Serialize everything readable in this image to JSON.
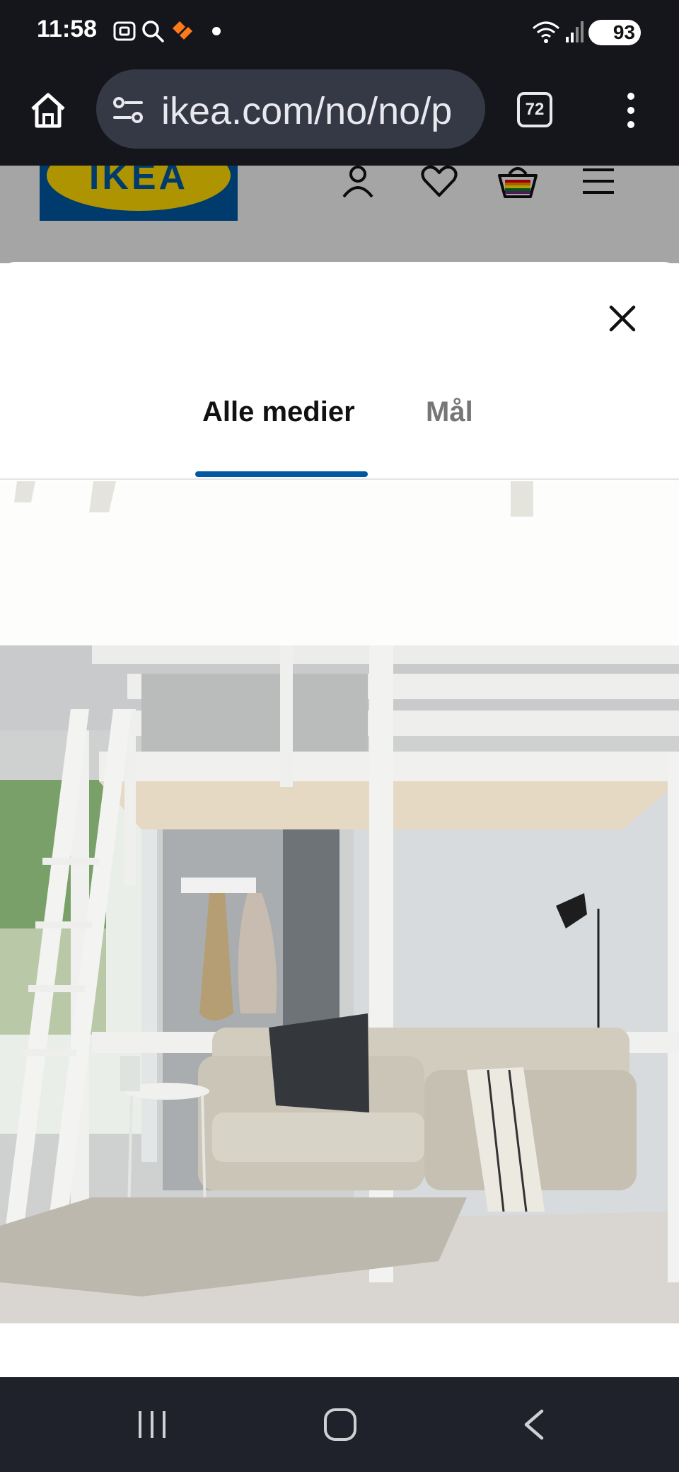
{
  "status_bar": {
    "time": "11:58",
    "battery": "93",
    "icons": [
      "screenshot-icon",
      "search-icon",
      "app-notification-icon",
      "dot-icon",
      "wifi-icon",
      "signal-icon",
      "battery-icon"
    ]
  },
  "browser": {
    "url": "ikea.com/no/no/p",
    "tab_count": "72",
    "icons": [
      "home-icon",
      "site-settings-icon",
      "tabs-icon",
      "more-icon"
    ]
  },
  "site_header": {
    "logo_text": "IKEA",
    "icons": [
      "account-icon",
      "favorites-icon",
      "cart-icon",
      "menu-icon"
    ]
  },
  "modal": {
    "tabs": [
      {
        "label": "Alle medier",
        "active": true
      },
      {
        "label": "Mål",
        "active": false
      }
    ],
    "accent_color": "#0058a3"
  }
}
